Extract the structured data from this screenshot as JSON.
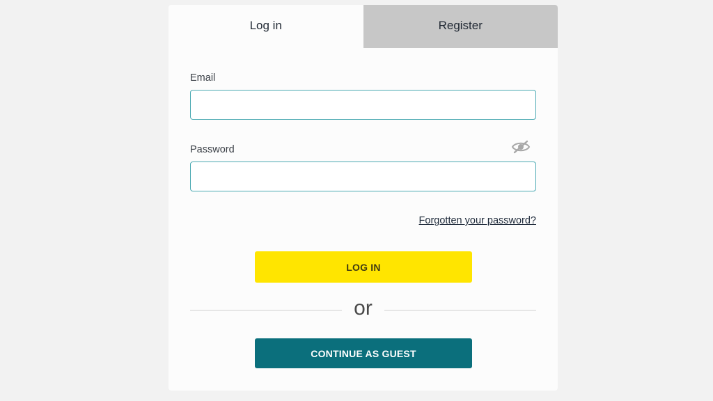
{
  "tabs": [
    {
      "label": "Log in",
      "active": true
    },
    {
      "label": "Register",
      "active": false
    }
  ],
  "form": {
    "email_label": "Email",
    "email_value": "",
    "password_label": "Password",
    "password_value": "",
    "password_toggle_icon": "eye-slash-icon",
    "forgot_label": "Forgotten your password?"
  },
  "actions": {
    "login_label": "LOG IN",
    "or_label": "or",
    "guest_label": "CONTINUE AS GUEST"
  },
  "colors": {
    "login_button": "#ffe500",
    "guest_button": "#0b6f7c",
    "input_border": "#4aa9b2",
    "inactive_tab": "#c7c7c7"
  }
}
